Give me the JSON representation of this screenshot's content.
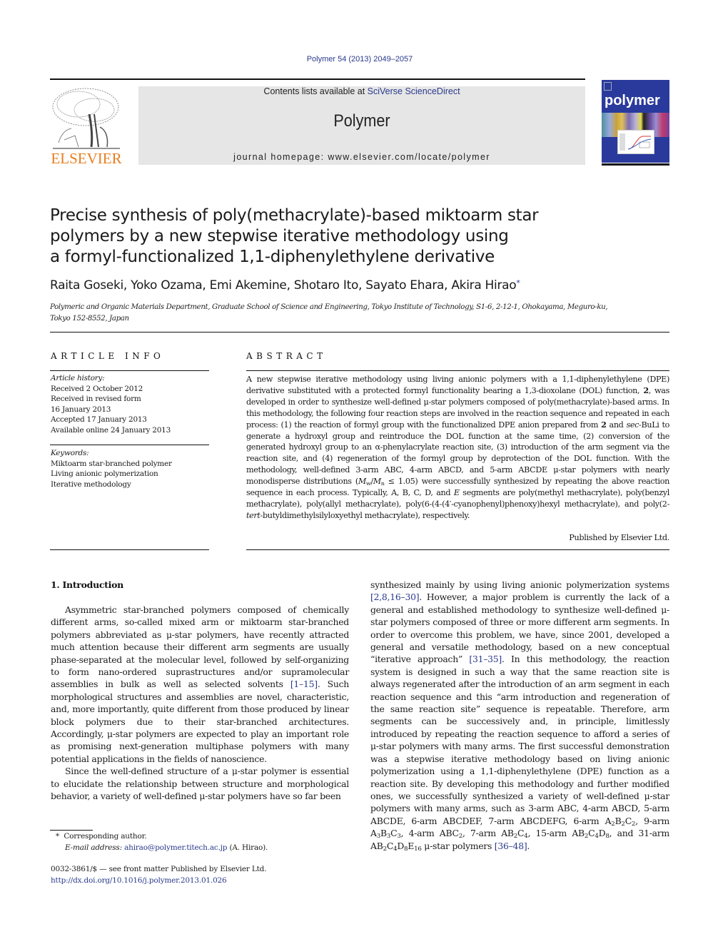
{
  "header": {
    "citation": "Polymer 54 (2013) 2049–2057",
    "contents_prefix": "Contents lists available at ",
    "contents_link": "SciVerse ScienceDirect",
    "journal_name": "Polymer",
    "homepage_line": "journal homepage: www.elsevier.com/locate/polymer",
    "publisher_logo_text": "ELSEVIER",
    "cover_title": "polymer"
  },
  "article": {
    "title_lines": [
      "Precise synthesis of poly(methacrylate)-based miktoarm star",
      "polymers by a new stepwise iterative methodology using",
      "a formyl-functionalized 1,1-diphenylethylene derivative"
    ],
    "authors": "Raita Goseki, Yoko Ozama, Emi Akemine, Shotaro Ito, Sayato Ehara, Akira Hirao",
    "corresponding_marker": "*",
    "affiliation_lines": [
      "Polymeric and Organic Materials Department, Graduate School of Science and Engineering, Tokyo Institute of Technology, S1-6, 2-12-1, Ohokayama, Meguro-ku,",
      "Tokyo 152-8552, Japan"
    ]
  },
  "article_info": {
    "heading": "ARTICLE INFO",
    "history_label": "Article history:",
    "history": [
      "Received 2 October 2012",
      "Received in revised form",
      "16 January 2013",
      "Accepted 17 January 2013",
      "Available online 24 January 2013"
    ],
    "keywords_label": "Keywords:",
    "keywords": [
      "Miktoarm star-branched polymer",
      "Living anionic polymerization",
      "Iterative methodology"
    ]
  },
  "abstract": {
    "heading": "ABSTRACT",
    "p1": "A new stepwise iterative methodology using living anionic polymers with a 1,1-diphenylethylene (DPE) derivative substituted with a protected formyl functionality bearing a 1,3-dioxolane (DOL) function, ",
    "compound": "2",
    "p2": ", was developed in order to synthesize well-defined μ-star polymers composed of poly(methacrylate)-based arms. In this methodology, the following four reaction steps are involved in the reaction sequence and repeated in each process: (1) the reaction of formyl group with the functionalized DPE anion prepared from ",
    "p3_reagent": "sec",
    "p3": "-BuLi to generate a hydroxyl group and reintroduce the DOL function at the same time, (2) conversion of the generated hydroxyl group to an α-phenylacrylate reaction site, (3) introduction of the arm segment via the reaction site, and (4) regeneration of the formyl group by deprotection of the DOL function. With the methodology, well-defined 3-arm ABC, 4-arm ABCD, and 5-arm ABCDE μ-star polymers with nearly monodisperse distributions (",
    "mw": "M",
    "mw_sub": "w",
    "mn": "M",
    "mn_sub": "n",
    "p4": " ≤ 1.05) were successfully synthesized by repeating the above reaction sequence in each process. Typically, A, B, C, D, and ",
    "seg_e": "E",
    "p5": " segments are poly(methyl methacrylate), poly(benzyl methacrylate), poly(allyl methacrylate), poly(6-(4-(4′-cyanophenyl)phenoxy)hexyl methacrylate), and poly(2-",
    "tert": "tert",
    "p6": "-butyldimethylsilyloxyethyl methacrylate), respectively.",
    "published_by": "Published by Elsevier Ltd."
  },
  "introduction": {
    "heading": "1.  Introduction",
    "left_p1_a": "Asymmetric star-branched polymers composed of chemically different arms, so-called mixed arm or miktoarm star-branched polymers abbreviated as μ-star polymers, have recently attracted much attention because their different arm segments are usually phase-separated at the molecular level, followed by self-organizing to form nano-ordered suprastructures and/or supramolecular assemblies in bulk as well as selected solvents ",
    "ref1": "[1–15]",
    "left_p1_b": ". Such morphological structures and assemblies are novel, characteristic, and, more importantly, quite different from those produced by linear block polymers due to their star-branched architectures. Accordingly, μ-star polymers are expected to play an important role as promising next-generation multiphase polymers with many potential applications in the fields of nanoscience.",
    "left_p2": "Since the well-defined structure of a μ-star polymer is essential to elucidate the relationship between structure and morphological behavior, a variety of well-defined μ-star polymers have so far been",
    "right_a": "synthesized mainly by using living anionic polymerization systems ",
    "ref2": "[2,8,16–30]",
    "right_b": ". However, a major problem is currently the lack of a general and established methodology to synthesize well-defined μ-star polymers composed of three or more different arm segments. In order to overcome this problem, we have, since 2001, developed a general and versatile methodology, based on a new conceptual “iterative approach” ",
    "ref3": "[31–35]",
    "right_c": ". In this methodology, the reaction system is designed in such a way that the same reaction site is always regenerated after the introduction of an arm segment in each reaction sequence and this “arm introduction and regeneration of the same reaction site” sequence is repeatable. Therefore, arm segments can be successively and, in principle, limitlessly introduced by repeating the reaction sequence to afford a series of μ-star polymers with many arms. The first successful demonstration was a stepwise iterative methodology based on living anionic polymerization using a 1,1-diphenylethylene (DPE) function as a reaction site. By developing this methodology and further modified ones, we successfully synthesized a variety of well-defined μ-star polymers with many arms, such as 3-arm ABC, 4-arm ABCD, 5-arm ABCDE, 6-arm ABCDEF, 7-arm ABCDEFG, 6-arm ",
    "formulas": {
      "f1": [
        "A",
        "2",
        "B",
        "2",
        "C",
        "2"
      ],
      "f2_prefix": ", 9-arm ",
      "f2": [
        "A",
        "3",
        "B",
        "3",
        "C",
        "3"
      ],
      "f3_prefix": ", 4-arm ABC",
      "f3_sub": "2",
      "f4_prefix": ", 7-arm AB",
      "f4": [
        "2",
        "C",
        "4"
      ],
      "f5_prefix": ", 15-arm AB",
      "f5": [
        "2",
        "C",
        "4",
        "D",
        "8"
      ],
      "f6_prefix": ", and 31-arm AB",
      "f6": [
        "2",
        "C",
        "4",
        "D",
        "8",
        "E",
        "16"
      ],
      "f6_suffix": " μ-star polymers "
    },
    "ref4": "[36–48]",
    "right_end": "."
  },
  "footnote": {
    "marker": "*",
    "corresponding": "Corresponding author.",
    "email_label": "E-mail address:",
    "email": "ahirao@polymer.titech.ac.jp",
    "email_suffix": " (A. Hirao)."
  },
  "front_matter": {
    "issn_line": "0032-3861/$ — see front matter Published by Elsevier Ltd.",
    "doi": "http://dx.doi.org/10.1016/j.polymer.2013.01.026"
  },
  "colors": {
    "link": "#2a3a8c",
    "elsevier_orange": "#e87d1e",
    "header_box": "#e6e6e6",
    "cover_blue": "#2a3a9c"
  }
}
